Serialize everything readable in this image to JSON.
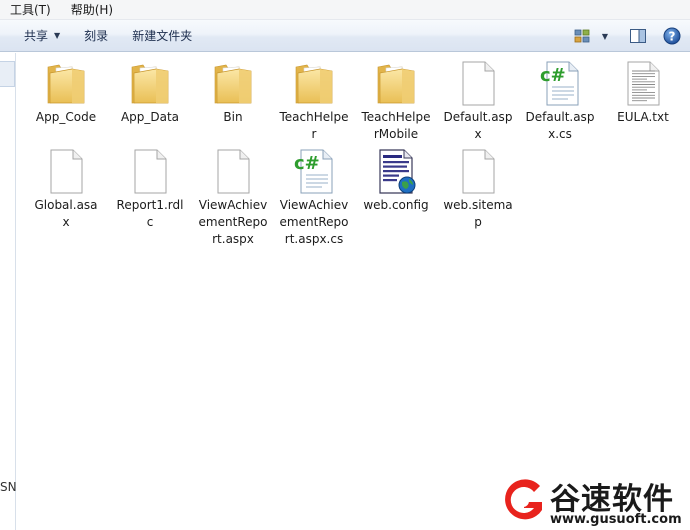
{
  "menubar": {
    "items": [
      {
        "label": "工具(T)"
      },
      {
        "label": "帮助(H)"
      }
    ]
  },
  "toolbar": {
    "share_label": "共享",
    "burn_label": "刻录",
    "new_folder_label": "新建文件夹",
    "view_icon": "view-options-icon",
    "pane_icon": "preview-pane-icon",
    "help_icon": "help-icon"
  },
  "navpane": {
    "partial_text": "SN"
  },
  "files": [
    {
      "name": "App_Code",
      "type": "folder"
    },
    {
      "name": "App_Data",
      "type": "folder"
    },
    {
      "name": "Bin",
      "type": "folder"
    },
    {
      "name": "TeachHelper",
      "type": "folder"
    },
    {
      "name": "TeachHelperMobile",
      "type": "folder"
    },
    {
      "name": "Default.aspx",
      "type": "blank"
    },
    {
      "name": "Default.aspx.cs",
      "type": "csharp"
    },
    {
      "name": "EULA.txt",
      "type": "text"
    },
    {
      "name": "Global.asax",
      "type": "blank"
    },
    {
      "name": "Report1.rdlc",
      "type": "blank"
    },
    {
      "name": "ViewAchievementReport.aspx",
      "type": "blank"
    },
    {
      "name": "ViewAchievementReport.aspx.cs",
      "type": "csharp"
    },
    {
      "name": "web.config",
      "type": "config"
    },
    {
      "name": "web.sitemap",
      "type": "blank"
    }
  ],
  "watermark": {
    "title": "谷速软件",
    "url": "www.gusuoft.com"
  },
  "colors": {
    "folder": "#f3d27a",
    "csharp_green": "#2e9d2e",
    "toolbar_text": "#1e2f4f",
    "logo_red": "#e8231d"
  }
}
